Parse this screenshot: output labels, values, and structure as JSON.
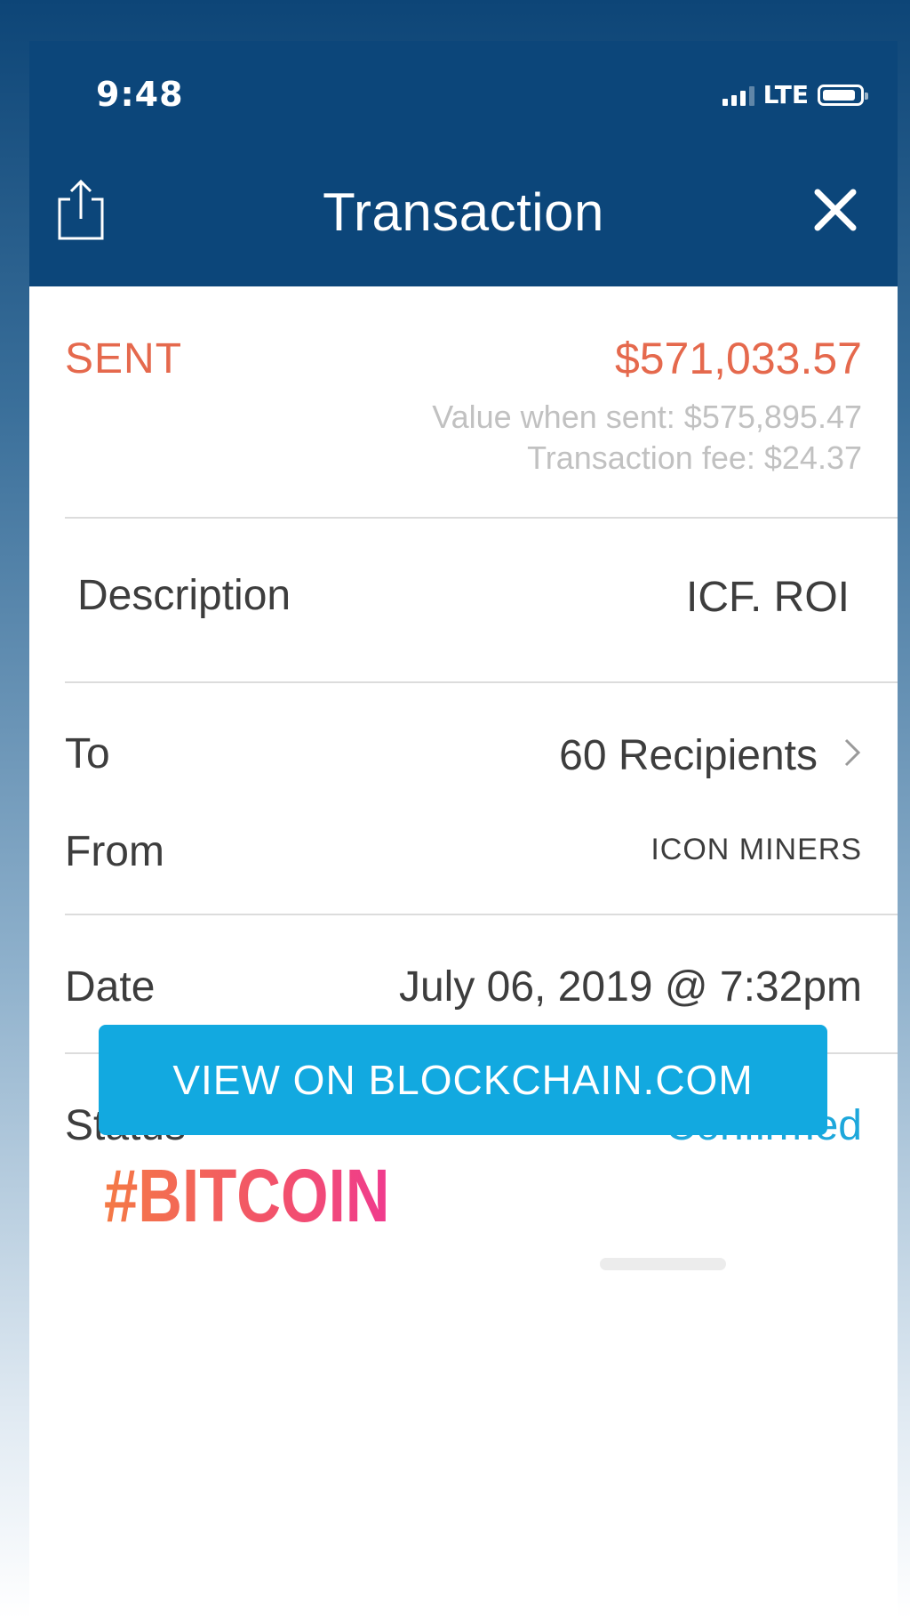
{
  "status_bar": {
    "time": "9:48",
    "network": "LTE"
  },
  "nav": {
    "title": "Transaction",
    "share_icon": "share-icon",
    "close_icon": "close-icon"
  },
  "summary": {
    "direction": "SENT",
    "amount": "$571,033.57",
    "value_when_sent": "Value when sent: $575,895.47",
    "fee": "Transaction fee: $24.37"
  },
  "details": {
    "description_label": "Description",
    "description_value": "ICF. ROI",
    "to_label": "To",
    "to_value": "60 Recipients",
    "from_label": "From",
    "from_value": "ICON MINERS",
    "date_label": "Date",
    "date_value": "July 06, 2019 @ 7:32pm",
    "status_label": "Status",
    "status_value": "Confirmed"
  },
  "action": {
    "label": "VIEW ON BLOCKCHAIN.COM"
  },
  "sticker": {
    "hashtag": "#BITCOIN"
  },
  "colors": {
    "header": "#0c467a",
    "sent": "#e5694d",
    "confirmed": "#1da7db",
    "button": "#12a9e0"
  }
}
